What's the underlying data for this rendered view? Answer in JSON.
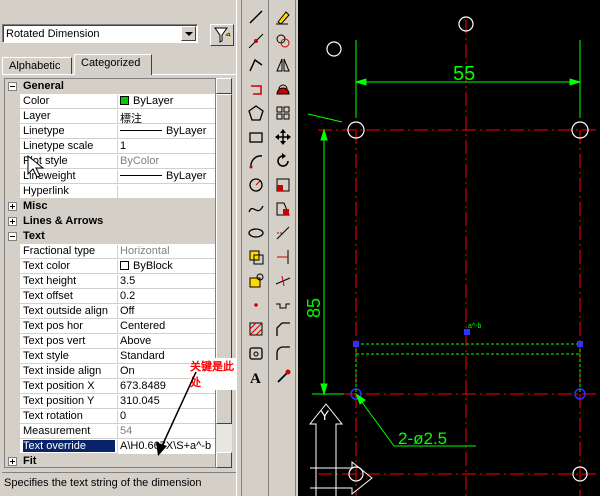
{
  "selector": {
    "value": "Rotated Dimension"
  },
  "tabs": [
    {
      "label": "Alphabetic"
    },
    {
      "label": "Categorized"
    }
  ],
  "categories": {
    "general": "General",
    "misc": "Misc",
    "lines_arrows": "Lines & Arrows",
    "text": "Text",
    "fit": "Fit"
  },
  "general_props": [
    {
      "name": "Color",
      "value": "ByLayer",
      "swatch": "#00cc00"
    },
    {
      "name": "Layer",
      "value": "標注"
    },
    {
      "name": "Linetype",
      "value": "ByLayer",
      "line": true
    },
    {
      "name": "Linetype scale",
      "value": "1"
    },
    {
      "name": "Plot style",
      "value": "ByColor",
      "disabled": true
    },
    {
      "name": "Lineweight",
      "value": "ByLayer",
      "line": true
    },
    {
      "name": "Hyperlink",
      "value": ""
    }
  ],
  "text_props": [
    {
      "name": "Fractional type",
      "value": "Horizontal",
      "disabled": true
    },
    {
      "name": "Text color",
      "value": "ByBlock",
      "swatch": "#ffffff"
    },
    {
      "name": "Text height",
      "value": "3.5"
    },
    {
      "name": "Text offset",
      "value": "0.2"
    },
    {
      "name": "Text outside align",
      "value": "Off"
    },
    {
      "name": "Text pos hor",
      "value": "Centered"
    },
    {
      "name": "Text pos vert",
      "value": "Above"
    },
    {
      "name": "Text style",
      "value": "Standard"
    },
    {
      "name": "Text inside align",
      "value": "On"
    },
    {
      "name": "Text position X",
      "value": "673.8489"
    },
    {
      "name": "Text position Y",
      "value": "310.045"
    },
    {
      "name": "Text rotation",
      "value": "0"
    },
    {
      "name": "Measurement",
      "value": "54",
      "disabled": true
    },
    {
      "name": "Text override",
      "value": "A\\H0.667X\\S+a^-b",
      "selected": true
    }
  ],
  "description": "Specifies the text string of the dimension",
  "annotation": "关键是此处",
  "drawing": {
    "dim_top": "55",
    "dim_left": "85",
    "hole_callout": "2-ø2.5",
    "ucs_label": "Y"
  },
  "colors": {
    "dimension": "#00ff00",
    "centerline": "#ff0000",
    "hatch_text": "#ffffff"
  }
}
